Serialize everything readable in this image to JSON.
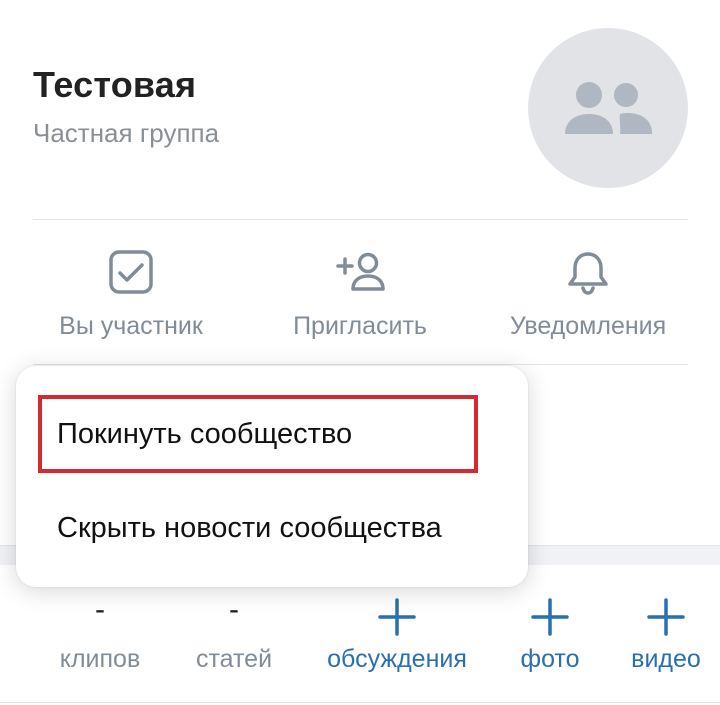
{
  "header": {
    "group_name": "Тестовая",
    "group_type": "Частная группа",
    "avatar_icon": "community-users-icon"
  },
  "actions": [
    {
      "label": "Вы участник",
      "icon": "checkbox-check-icon"
    },
    {
      "label": "Пригласить",
      "icon": "add-user-icon"
    },
    {
      "label": "Уведомления",
      "icon": "bell-icon"
    }
  ],
  "menu": {
    "items": [
      {
        "label": "Покинуть сообщество",
        "highlighted": true
      },
      {
        "label": "Скрыть новости сообщества",
        "highlighted": false
      }
    ]
  },
  "counters": [
    {
      "value": "-",
      "label": "клипов"
    },
    {
      "value": "-",
      "label": "статей"
    },
    {
      "value": "+",
      "label": "обсуждения",
      "icon": "plus-icon"
    },
    {
      "value": "+",
      "label": "фото",
      "icon": "plus-icon"
    },
    {
      "value": "+",
      "label": "видео",
      "icon": "plus-icon"
    }
  ],
  "colors": {
    "accent": "#2a6fb0",
    "icon_gray": "#818c99",
    "highlight_border": "#d42a2f",
    "avatar_bg": "#e1e3e6"
  }
}
